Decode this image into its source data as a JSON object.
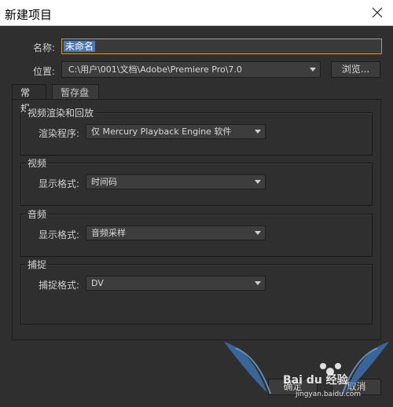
{
  "window": {
    "title": "新建项目"
  },
  "form": {
    "name_label": "名称:",
    "name_value": "未命名",
    "location_label": "位置:",
    "location_value": "C:\\用户\\001\\文档\\Adobe\\Premiere Pro\\7.0",
    "browse_label": "浏览..."
  },
  "tabs": [
    {
      "label": "常规",
      "active": true
    },
    {
      "label": "暂存盘",
      "active": false
    }
  ],
  "groups": {
    "playback": {
      "title": "视频渲染和回放",
      "field_label": "渲染程序:",
      "value": "仅 Mercury Playback Engine 软件"
    },
    "video": {
      "title": "视频",
      "field_label": "显示格式:",
      "value": "时间码"
    },
    "audio": {
      "title": "音频",
      "field_label": "显示格式:",
      "value": "音频采样"
    },
    "capture": {
      "title": "捕捉",
      "field_label": "捕捉格式:",
      "value": "DV"
    }
  },
  "footer": {
    "ok_label": "确定",
    "cancel_label": "取消"
  },
  "watermark": {
    "brand": "Bai du 经验",
    "url": "jingyan.baidu.com"
  },
  "colors": {
    "dialog_bg": "#2f2f2f",
    "input_focus_border": "#c79a2f",
    "selection": "#4a79b8"
  }
}
